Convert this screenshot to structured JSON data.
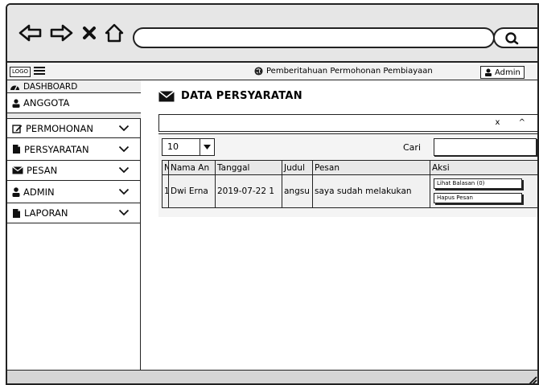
{
  "browser": {
    "back_icon": "arrow-left-icon",
    "forward_icon": "arrow-right-icon",
    "close_icon": "close-icon",
    "home_icon": "home-icon",
    "url_value": "",
    "search_icon": "search-icon"
  },
  "topbar": {
    "logo": "LOGO",
    "notification": "Pemberitahuan Permohonan Pembiayaan",
    "admin": "Admin"
  },
  "sidebar": {
    "items": [
      {
        "label": "DASHBOARD",
        "icon": "dashboard-icon"
      },
      {
        "label": "ANGGOTA",
        "icon": "user-icon"
      },
      {
        "label": "PERMOHONAN",
        "icon": "edit-icon"
      },
      {
        "label": "PERSYARATAN",
        "icon": "file-icon"
      },
      {
        "label": "PESAN",
        "icon": "envelope-icon"
      },
      {
        "label": "ADMIN",
        "icon": "user-icon"
      },
      {
        "label": "LAPORAN",
        "icon": "file-icon"
      }
    ]
  },
  "main": {
    "title": "DATA PERSYARATAN",
    "collapse_controls": "x ^",
    "length_value": "10",
    "search_label": "Cari",
    "search_value": "",
    "columns": [
      "N",
      "Nama An",
      "Tanggal",
      "Judul",
      "Pesan",
      "Aksi"
    ],
    "rows": [
      {
        "no": "1",
        "nama": "Dwi Erna",
        "tanggal": "2019-07-22 1",
        "judul": "angsu",
        "pesan": "saya sudah melakukan",
        "aksi": [
          "Lihat Balasan (0)",
          "Hapus Pesan"
        ]
      }
    ]
  },
  "colors": {
    "chrome_bg": "#e6e6e6",
    "stroke": "#222222",
    "panel_bg": "#f4f4f4"
  }
}
